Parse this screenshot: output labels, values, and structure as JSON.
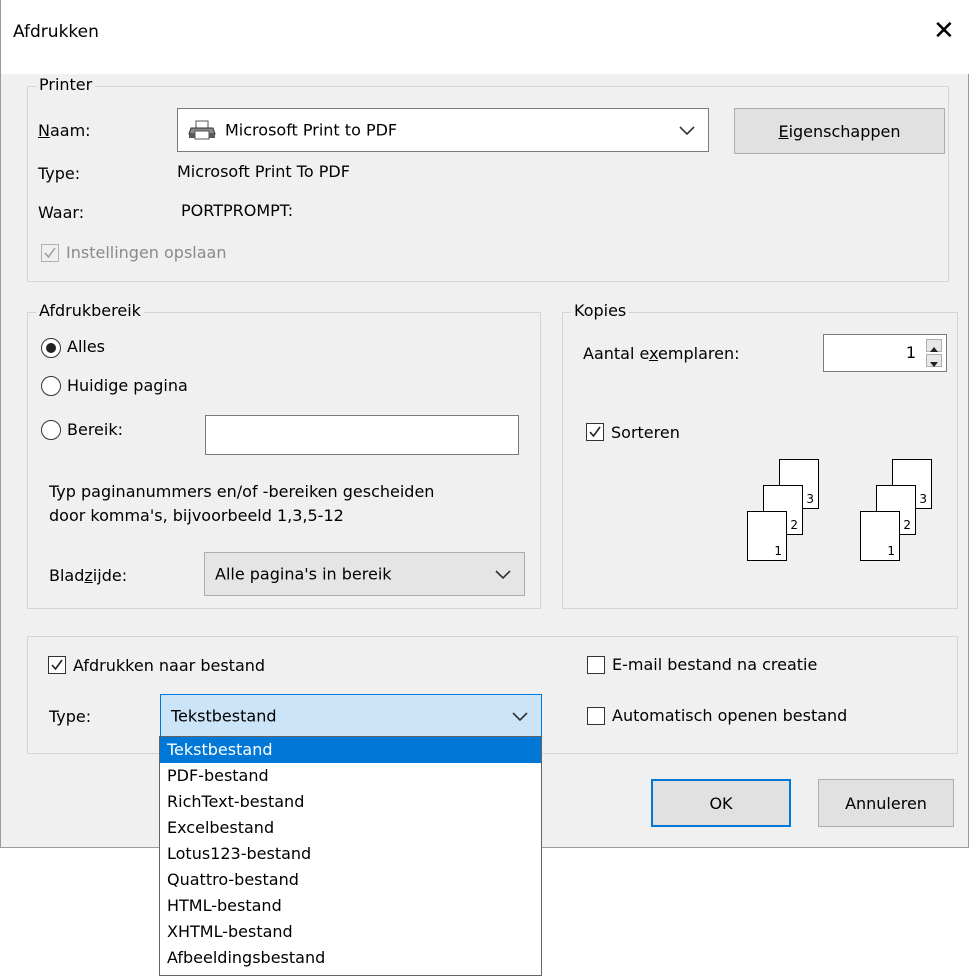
{
  "dialog": {
    "title": "Afdrukken",
    "close_glyph": "✕"
  },
  "printer": {
    "legend": "Printer",
    "name_label_u": "N",
    "name_label_rest": "aam:",
    "name_value": "Microsoft Print to PDF",
    "name_icon": "printer-icon",
    "properties_u": "E",
    "properties_rest": "igenschappen",
    "type_label": "Type:",
    "type_value": "Microsoft Print To PDF",
    "where_label": "Waar:",
    "where_value": "PORTPROMPT:",
    "save_settings": "Instellingen opslaan"
  },
  "range": {
    "legend": "Afdrukbereik",
    "all": "Alles",
    "current_page": "Huidige pagina",
    "range_label": "Bereik:",
    "help_line1": "Typ paginanummers en/of -bereiken gescheiden",
    "help_line2": "door komma's, bijvoorbeeld 1,3,5-12",
    "page_label_pre": "Blad",
    "page_label_u": "z",
    "page_label_post": "ijde:",
    "page_value": "Alle pagina's in bereik"
  },
  "copies": {
    "legend": "Kopies",
    "count_label_pre": "Aantal e",
    "count_label_u": "x",
    "count_label_post": "emplaren:",
    "count_value": "1",
    "sort_label": "Sorteren",
    "page_numbers": [
      "1",
      "2",
      "3"
    ]
  },
  "output": {
    "print_to_file": "Afdrukken naar bestand",
    "type_label": "Type:",
    "type_value": "Tekstbestand",
    "email_after": "E-mail bestand na creatie",
    "auto_open": "Automatisch openen bestand",
    "type_options": [
      "Tekstbestand",
      "PDF-bestand",
      "RichText-bestand",
      "Excelbestand",
      "Lotus123-bestand",
      "Quattro-bestand",
      "HTML-bestand",
      "XHTML-bestand",
      "Afbeeldingsbestand"
    ]
  },
  "buttons": {
    "ok": "OK",
    "cancel": "Annuleren"
  },
  "colors": {
    "accent": "#0078d7",
    "dialog_bg": "#f0f0f0",
    "selected_text": "#ffffff"
  }
}
